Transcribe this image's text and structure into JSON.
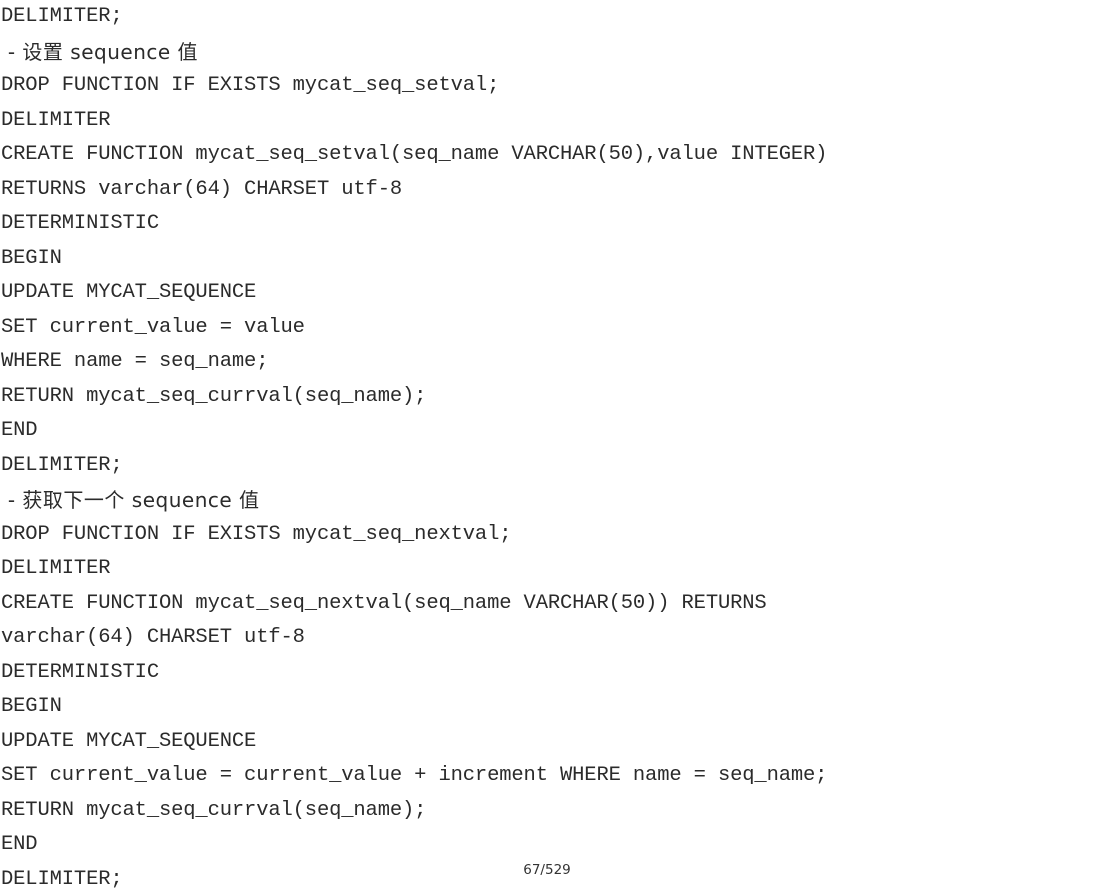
{
  "document": {
    "background_color": "#ffffff",
    "text_color": "#2b2b2b",
    "page_indicator": "67/529",
    "current_page": 67,
    "total_pages": 529
  },
  "code": {
    "language": "sql",
    "lines": [
      {
        "text": "DELIMITER;",
        "cjk": false
      },
      {
        "text": " - 设置 sequence 值",
        "cjk": true
      },
      {
        "text": "DROP FUNCTION IF EXISTS mycat_seq_setval;",
        "cjk": false
      },
      {
        "text": "DELIMITER",
        "cjk": false
      },
      {
        "text": "CREATE FUNCTION mycat_seq_setval(seq_name VARCHAR(50),value INTEGER)",
        "cjk": false
      },
      {
        "text": "RETURNS varchar(64) CHARSET utf-8",
        "cjk": false
      },
      {
        "text": "DETERMINISTIC",
        "cjk": false
      },
      {
        "text": "BEGIN",
        "cjk": false
      },
      {
        "text": "UPDATE MYCAT_SEQUENCE",
        "cjk": false
      },
      {
        "text": "SET current_value = value",
        "cjk": false
      },
      {
        "text": "WHERE name = seq_name;",
        "cjk": false
      },
      {
        "text": "RETURN mycat_seq_currval(seq_name);",
        "cjk": false
      },
      {
        "text": "END",
        "cjk": false
      },
      {
        "text": "DELIMITER;",
        "cjk": false
      },
      {
        "text": " - 获取下一个 sequence 值",
        "cjk": true
      },
      {
        "text": "DROP FUNCTION IF EXISTS mycat_seq_nextval;",
        "cjk": false
      },
      {
        "text": "DELIMITER",
        "cjk": false
      },
      {
        "text": "CREATE FUNCTION mycat_seq_nextval(seq_name VARCHAR(50)) RETURNS",
        "cjk": false
      },
      {
        "text": "varchar(64) CHARSET utf-8",
        "cjk": false
      },
      {
        "text": "DETERMINISTIC",
        "cjk": false
      },
      {
        "text": "BEGIN",
        "cjk": false
      },
      {
        "text": "UPDATE MYCAT_SEQUENCE",
        "cjk": false
      },
      {
        "text": "SET current_value = current_value + increment WHERE name = seq_name;",
        "cjk": false
      },
      {
        "text": "RETURN mycat_seq_currval(seq_name);",
        "cjk": false
      },
      {
        "text": "END",
        "cjk": false
      },
      {
        "text": "DELIMITER;",
        "cjk": false
      }
    ]
  }
}
